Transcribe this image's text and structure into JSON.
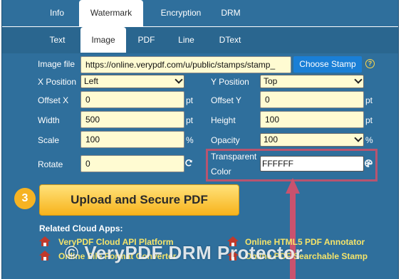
{
  "top_tabs": [
    "Info",
    "Watermark",
    "Encryption",
    "DRM"
  ],
  "sub_tabs": [
    "Text",
    "Image",
    "PDF",
    "Line",
    "DText"
  ],
  "image_file": {
    "label": "Image file",
    "value": "https://online.verypdf.com/u/public/stamps/stamp_",
    "button": "Choose Stamp"
  },
  "x_position": {
    "label": "X Position",
    "value": "Left"
  },
  "y_position": {
    "label": "Y Position",
    "value": "Top"
  },
  "offset_x": {
    "label": "Offset X",
    "value": "0",
    "unit": "pt"
  },
  "offset_y": {
    "label": "Offset Y",
    "value": "0",
    "unit": "pt"
  },
  "width": {
    "label": "Width",
    "value": "500",
    "unit": "pt"
  },
  "height": {
    "label": "Height",
    "value": "100",
    "unit": "pt"
  },
  "scale": {
    "label": "Scale",
    "value": "100",
    "unit": "%"
  },
  "opacity": {
    "label": "Opacity",
    "value": "100",
    "unit": "%"
  },
  "rotate": {
    "label": "Rotate",
    "value": "0"
  },
  "transparent_color": {
    "label_1": "Transparent",
    "label_2": "Color",
    "value": "FFFFFF"
  },
  "upload": {
    "step": "3",
    "label": "Upload and Secure PDF"
  },
  "related": {
    "title": "Related Cloud Apps:",
    "links": [
      "VeryPDF Cloud API Platform",
      "Online HTML5 PDF Annotator",
      "Online File Format Converter",
      "Online PDF Searchable Stamp"
    ]
  },
  "watermark_text": "© VeryPDF DRM Protector",
  "colors": {
    "panel": "#2f6f9c",
    "field": "#fffbd2",
    "accent": "#1a7fd6",
    "highlight": "#b8546f",
    "link": "#f5e46a"
  }
}
